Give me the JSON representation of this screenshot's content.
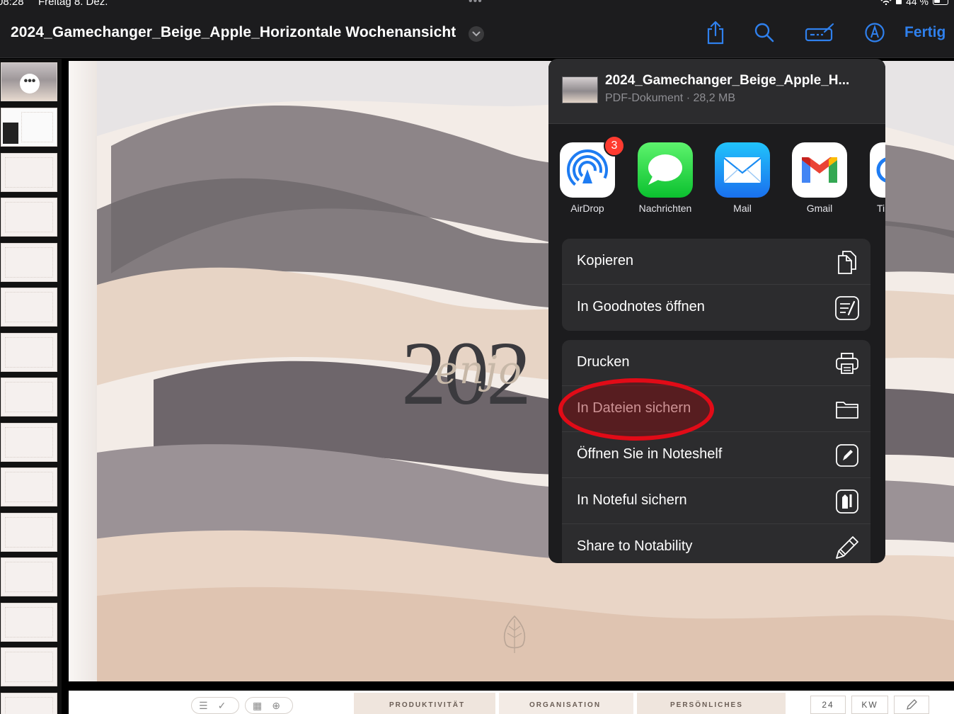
{
  "status_bar": {
    "time": "08:28",
    "date": "Freitag 8. Dez.",
    "multitask_dots": "•••",
    "battery": "44 %"
  },
  "toolbar": {
    "document_title": "2024_Gamechanger_Beige_Apple_Horizontale Wochenansicht",
    "done_label": "Fertig",
    "icons": [
      "share-icon",
      "search-icon",
      "annotate-icon",
      "markup-icon"
    ],
    "accent_color": "#2f80ed"
  },
  "sidebar": {
    "thumbnail_count": 15,
    "more_glyph": "•••"
  },
  "page": {
    "year": "202",
    "script": "enjo"
  },
  "bottom_nav": {
    "tabs": [
      "PRODUKTIVITÄT",
      "ORGANISATION",
      "PERSÖNLICHES"
    ],
    "week_number": "24",
    "week_label": "KW"
  },
  "share_sheet": {
    "file_name": "2024_Gamechanger_Beige_Apple_H...",
    "file_info": "PDF-Dokument · 28,2 MB",
    "apps": [
      {
        "label": "AirDrop",
        "badge": "3",
        "icon": "airdrop-icon"
      },
      {
        "label": "Nachrichten",
        "icon": "messages-icon"
      },
      {
        "label": "Mail",
        "icon": "mail-icon"
      },
      {
        "label": "Gmail",
        "icon": "gmail-icon"
      },
      {
        "label": "Ti",
        "icon": "partial-app-icon"
      }
    ],
    "actions_group_1": [
      {
        "label": "Kopieren",
        "icon": "copy-icon"
      },
      {
        "label": "In Goodnotes öffnen",
        "icon": "goodnotes-icon"
      }
    ],
    "actions_group_2": [
      {
        "label": "Drucken",
        "icon": "printer-icon"
      },
      {
        "label": "In Dateien sichern",
        "icon": "folder-icon"
      },
      {
        "label": "Öffnen Sie in Noteshelf",
        "icon": "noteshelf-icon"
      },
      {
        "label": "In Noteful sichern",
        "icon": "noteful-icon"
      },
      {
        "label": "Share to Notability",
        "icon": "pencil-icon"
      }
    ],
    "highlight_color": "#e10b17"
  }
}
